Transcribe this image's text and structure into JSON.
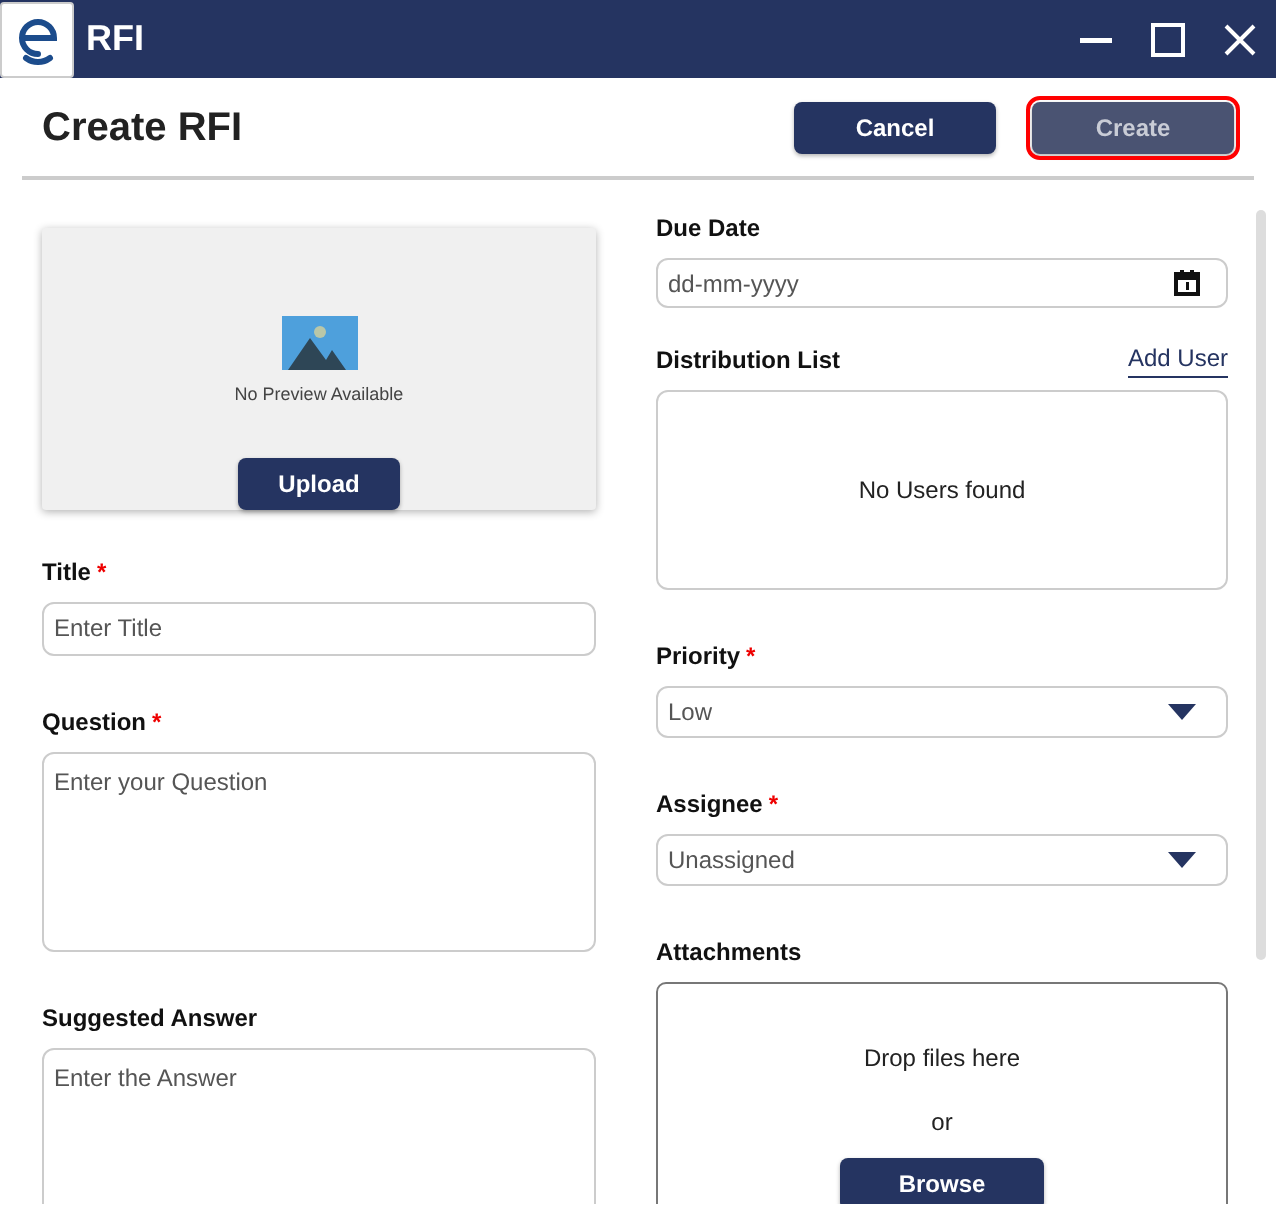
{
  "window": {
    "title": "RFI"
  },
  "header": {
    "title": "Create RFI",
    "buttons": [
      {
        "label": "Cancel",
        "disabled": false,
        "focused": false
      },
      {
        "label": "Create",
        "disabled": true,
        "focused": true
      }
    ]
  },
  "required_mark": "*",
  "preview": {
    "caption": "No Preview Available",
    "button": "Upload"
  },
  "left_fields": [
    {
      "kind": "input",
      "label": "Title",
      "required": true,
      "placeholder": "Enter Title"
    },
    {
      "kind": "textarea",
      "label": "Question",
      "required": true,
      "placeholder": "Enter your Question"
    },
    {
      "kind": "textarea",
      "label": "Suggested Answer",
      "required": false,
      "placeholder": "Enter the Answer"
    }
  ],
  "right_fields": [
    {
      "kind": "date",
      "label": "Due Date",
      "required": false,
      "placeholder": "dd-mm-yyyy"
    },
    {
      "kind": "list",
      "label": "Distribution List",
      "required": false,
      "link": "Add User",
      "empty_text": "No Users found"
    },
    {
      "kind": "select",
      "label": "Priority",
      "required": true,
      "value": "Low"
    },
    {
      "kind": "select",
      "label": "Assignee",
      "required": true,
      "value": "Unassigned"
    },
    {
      "kind": "drop",
      "label": "Attachments",
      "required": false,
      "drop_text": "Drop files here",
      "or_text": "or",
      "button": "Browse"
    }
  ]
}
